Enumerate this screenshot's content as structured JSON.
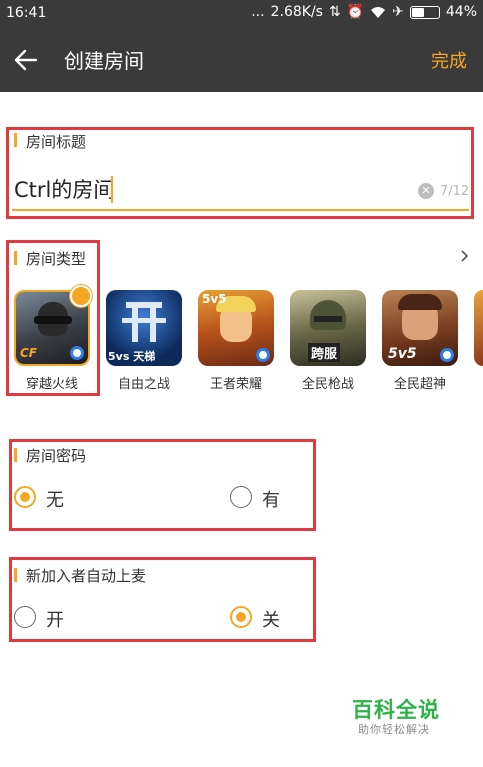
{
  "status_bar": {
    "time": "16:41",
    "dots": "...",
    "speed": "2.68K/s",
    "battery": "44%"
  },
  "header": {
    "title": "创建房间",
    "done_label": "完成"
  },
  "room_title": {
    "label": "房间标题",
    "value": "Ctrl的房间",
    "count": "7/12"
  },
  "room_type": {
    "label": "房间类型",
    "games": [
      {
        "name": "穿越火线",
        "selected": true
      },
      {
        "name": "自由之战",
        "badge": "5vs 天梯"
      },
      {
        "name": "王者荣耀",
        "badge": "5v5"
      },
      {
        "name": "全民枪战",
        "badge": "跨服"
      },
      {
        "name": "全民超神",
        "badge": "5v5"
      }
    ]
  },
  "password": {
    "label": "房间密码",
    "options": [
      "无",
      "有"
    ],
    "selected": "无"
  },
  "auto_mic": {
    "label": "新加入者自动上麦",
    "options": [
      "开",
      "关"
    ],
    "selected": "关"
  },
  "watermark": {
    "title": "百科全说",
    "subtitle": "助你轻松解决"
  },
  "colors": {
    "accent": "#f5a623",
    "highlight_box": "#e0393e",
    "app_bar": "#3a3a3a"
  }
}
